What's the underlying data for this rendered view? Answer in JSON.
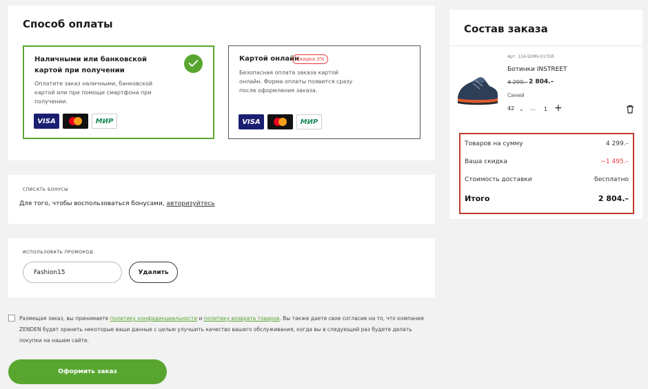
{
  "payment": {
    "title": "Способ оплаты",
    "options": [
      {
        "title": "Наличными или банковской картой при получении",
        "description": "Оплатите заказ наличными, банковской картой или при помощи смартфона при получении.",
        "selected": true,
        "badge": ""
      },
      {
        "title": "Картой онлайн",
        "description": "Безопасная оплата заказа картой онлайн. Форма оплаты появится сразу после оформления заказа.",
        "selected": false,
        "badge": "Скидка 3%"
      }
    ],
    "card_logos": [
      "VISA",
      "mastercard",
      "МИР"
    ]
  },
  "bonus": {
    "label": "СПИСАТЬ БОНУСЫ",
    "text": "Для того, чтобы воспользоваться бонусами, ",
    "link": "авторизуйтесь"
  },
  "promo": {
    "label": "ИСПОЛЬЗОВАТЬ ПРОМОКОД",
    "value": "Fashion15",
    "delete_label": "Удалить"
  },
  "consent": {
    "text1": "Размещая заказ, вы принимаете ",
    "link1": "политику конфиденциальности",
    "text2": " и ",
    "link2": "политику возврата товаров",
    "text3": ". Вы также даете свое согласие на то, что компания ZENDEN будет хранить некоторые ваши данные с целью улучшить качество вашего обслуживания, когда вы в следующий раз будете делать покупки на нашем сайте."
  },
  "submit_label": "Оформить заказ",
  "order": {
    "title": "Состав заказа",
    "item": {
      "article": "Арт. 116-92MV-017GR",
      "name": "Ботинки INSTREET",
      "old_price": "4 299.–",
      "new_price": "2 804.–",
      "color": "Синий",
      "size": "42",
      "quantity": "1"
    },
    "summary": {
      "goods_label": "Товаров на сумму",
      "goods_value": "4 299.–",
      "discount_label": "Ваша скидка",
      "discount_value": "−1 495.–",
      "delivery_label": "Стоимость доставки",
      "delivery_value": "бесплатно",
      "total_label": "Итого",
      "total_value": "2 804.–"
    }
  },
  "colors": {
    "accent": "#58a630",
    "discount": "#e53935",
    "highlight_border": "#c0392b"
  }
}
